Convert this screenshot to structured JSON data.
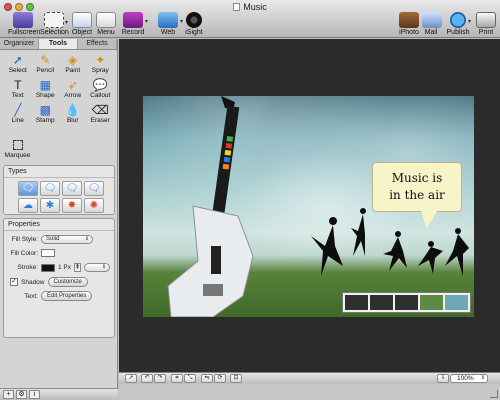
{
  "window": {
    "title": "Music"
  },
  "toolbar": {
    "left": [
      {
        "label": "Fullscreen",
        "icon": "fullscreen-icon"
      },
      {
        "label": "Selection",
        "icon": "selection-icon"
      },
      {
        "label": "Object",
        "icon": "object-icon"
      },
      {
        "label": "Menu",
        "icon": "menu-icon"
      },
      {
        "label": "Record",
        "icon": "record-icon"
      },
      {
        "label": "Web",
        "icon": "web-icon"
      },
      {
        "label": "iSight",
        "icon": "isight-icon"
      }
    ],
    "right": [
      {
        "label": "iPhoto",
        "icon": "iphoto-icon"
      },
      {
        "label": "Mail",
        "icon": "mail-icon"
      },
      {
        "label": "Publish",
        "icon": "publish-icon"
      },
      {
        "label": "Print",
        "icon": "print-icon"
      }
    ]
  },
  "sidebar": {
    "tabs": [
      {
        "label": "Organizer",
        "active": false
      },
      {
        "label": "Tools",
        "active": true
      },
      {
        "label": "Effects",
        "active": false
      }
    ],
    "tools": [
      {
        "label": "Select",
        "glyph": "➚"
      },
      {
        "label": "Pencil",
        "glyph": "✎"
      },
      {
        "label": "Paint",
        "glyph": "◈"
      },
      {
        "label": "Spray",
        "glyph": "✦"
      },
      {
        "label": "Text",
        "glyph": "T"
      },
      {
        "label": "Shape",
        "glyph": "▦"
      },
      {
        "label": "Arrow",
        "glyph": "➶"
      },
      {
        "label": "Callout",
        "glyph": "💬"
      },
      {
        "label": "Line",
        "glyph": "╱"
      },
      {
        "label": "Stamp",
        "glyph": "▩"
      },
      {
        "label": "Blur",
        "glyph": "💧"
      },
      {
        "label": "Eraser",
        "glyph": "⌫"
      }
    ],
    "marquee_label": "Marquee",
    "types_title": "Types",
    "types": [
      {
        "glyph": "🗨",
        "selected": true
      },
      {
        "glyph": "🗨",
        "selected": false
      },
      {
        "glyph": "🗨",
        "selected": false
      },
      {
        "glyph": "🗨",
        "selected": false
      },
      {
        "glyph": "☁",
        "selected": false
      },
      {
        "glyph": "✱",
        "selected": false
      },
      {
        "glyph": "✸",
        "selected": false,
        "hot": true
      },
      {
        "glyph": "✺",
        "selected": false,
        "hot": true
      }
    ],
    "properties": {
      "title": "Properties",
      "fill_style_label": "Fill Style:",
      "fill_style_value": "Solid",
      "fill_color_label": "Fill Color:",
      "stroke_label": "Stroke:",
      "stroke_width": "1 Px",
      "shadow_label": "Shadow",
      "shadow_checked": true,
      "customize_label": "Customize",
      "text_label": "Text:",
      "edit_properties_label": "Edit Properties"
    }
  },
  "canvas": {
    "callout_line1": "Music is",
    "callout_line2": "in the air"
  },
  "zoom": {
    "value": "100%"
  }
}
